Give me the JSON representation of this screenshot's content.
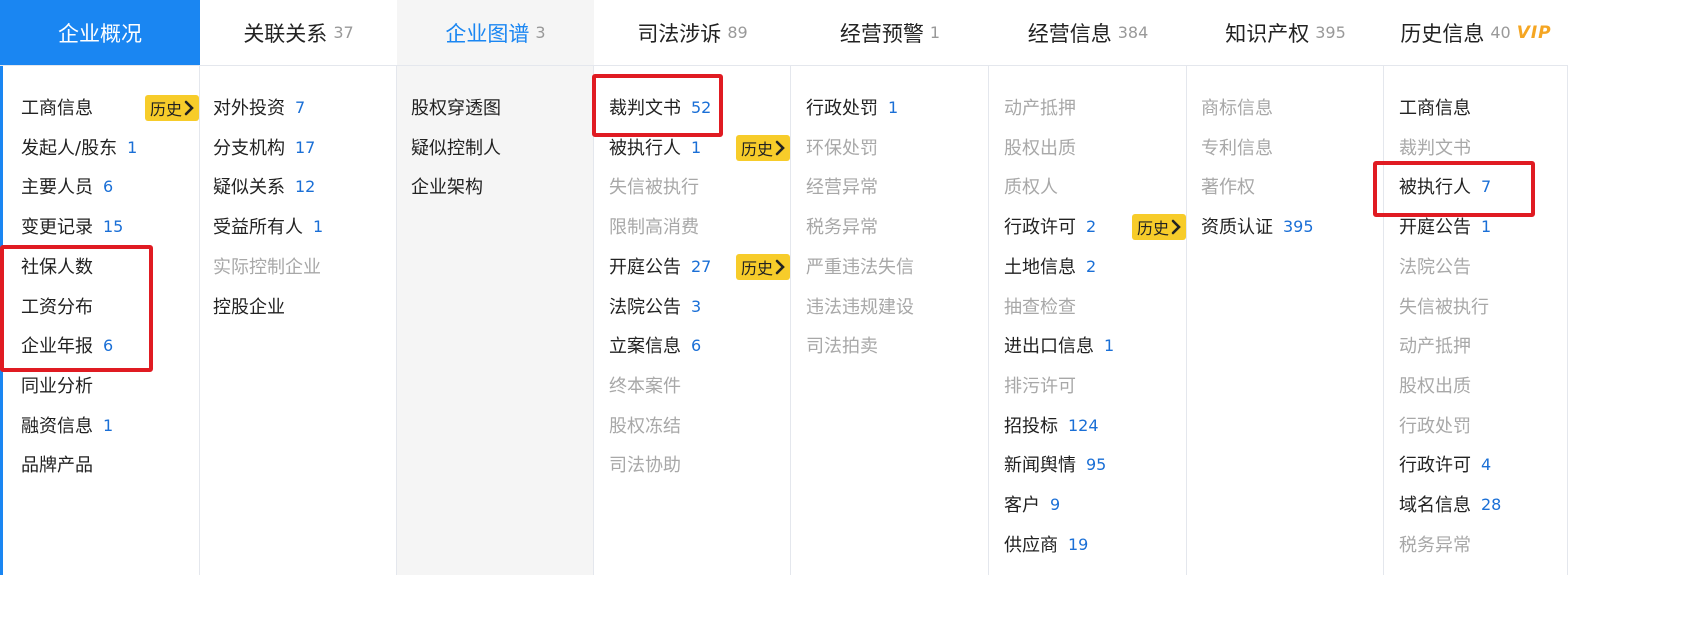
{
  "tabs": [
    {
      "label": "企业概况",
      "count": "",
      "state": "active"
    },
    {
      "label": "关联关系",
      "count": "37",
      "state": "normal"
    },
    {
      "label": "企业图谱",
      "count": "3",
      "state": "shaded"
    },
    {
      "label": "司法涉诉",
      "count": "89",
      "state": "normal"
    },
    {
      "label": "经营预警",
      "count": "1",
      "state": "normal"
    },
    {
      "label": "经营信息",
      "count": "384",
      "state": "normal"
    },
    {
      "label": "知识产权",
      "count": "395",
      "state": "normal"
    },
    {
      "label": "历史信息",
      "count": "40",
      "state": "normal",
      "badge": "VIP"
    }
  ],
  "history_label": "历史",
  "columns": [
    {
      "items": [
        {
          "label": "工商信息",
          "count": "",
          "disabled": false,
          "history": true
        },
        {
          "label": "发起人/股东",
          "count": "1",
          "disabled": false
        },
        {
          "label": "主要人员",
          "count": "6",
          "disabled": false
        },
        {
          "label": "变更记录",
          "count": "15",
          "disabled": false
        },
        {
          "label": "社保人数",
          "count": "",
          "disabled": false
        },
        {
          "label": "工资分布",
          "count": "",
          "disabled": false
        },
        {
          "label": "企业年报",
          "count": "6",
          "disabled": false
        },
        {
          "label": "同业分析",
          "count": "",
          "disabled": false
        },
        {
          "label": "融资信息",
          "count": "1",
          "disabled": false
        },
        {
          "label": "品牌产品",
          "count": "",
          "disabled": false
        }
      ]
    },
    {
      "items": [
        {
          "label": "对外投资",
          "count": "7",
          "disabled": false
        },
        {
          "label": "分支机构",
          "count": "17",
          "disabled": false
        },
        {
          "label": "疑似关系",
          "count": "12",
          "disabled": false
        },
        {
          "label": "受益所有人",
          "count": "1",
          "disabled": false
        },
        {
          "label": "实际控制企业",
          "count": "",
          "disabled": true
        },
        {
          "label": "控股企业",
          "count": "",
          "disabled": false
        }
      ]
    },
    {
      "items": [
        {
          "label": "股权穿透图",
          "count": "",
          "disabled": false
        },
        {
          "label": "疑似控制人",
          "count": "",
          "disabled": false
        },
        {
          "label": "企业架构",
          "count": "",
          "disabled": false
        }
      ]
    },
    {
      "items": [
        {
          "label": "裁判文书",
          "count": "52",
          "disabled": false
        },
        {
          "label": "被执行人",
          "count": "1",
          "disabled": false,
          "history": true
        },
        {
          "label": "失信被执行",
          "count": "",
          "disabled": true
        },
        {
          "label": "限制高消费",
          "count": "",
          "disabled": true
        },
        {
          "label": "开庭公告",
          "count": "27",
          "disabled": false,
          "history": true
        },
        {
          "label": "法院公告",
          "count": "3",
          "disabled": false
        },
        {
          "label": "立案信息",
          "count": "6",
          "disabled": false
        },
        {
          "label": "终本案件",
          "count": "",
          "disabled": true
        },
        {
          "label": "股权冻结",
          "count": "",
          "disabled": true
        },
        {
          "label": "司法协助",
          "count": "",
          "disabled": true
        }
      ]
    },
    {
      "items": [
        {
          "label": "行政处罚",
          "count": "1",
          "disabled": false
        },
        {
          "label": "环保处罚",
          "count": "",
          "disabled": true
        },
        {
          "label": "经营异常",
          "count": "",
          "disabled": true
        },
        {
          "label": "税务异常",
          "count": "",
          "disabled": true
        },
        {
          "label": "严重违法失信",
          "count": "",
          "disabled": true
        },
        {
          "label": "违法违规建设",
          "count": "",
          "disabled": true
        },
        {
          "label": "司法拍卖",
          "count": "",
          "disabled": true
        }
      ]
    },
    {
      "items": [
        {
          "label": "动产抵押",
          "count": "",
          "disabled": true
        },
        {
          "label": "股权出质",
          "count": "",
          "disabled": true
        },
        {
          "label": "质权人",
          "count": "",
          "disabled": true
        },
        {
          "label": "行政许可",
          "count": "2",
          "disabled": false,
          "history": true
        },
        {
          "label": "土地信息",
          "count": "2",
          "disabled": false
        },
        {
          "label": "抽查检查",
          "count": "",
          "disabled": true
        },
        {
          "label": "进出口信息",
          "count": "1",
          "disabled": false
        },
        {
          "label": "排污许可",
          "count": "",
          "disabled": true
        },
        {
          "label": "招投标",
          "count": "124",
          "disabled": false
        },
        {
          "label": "新闻舆情",
          "count": "95",
          "disabled": false
        },
        {
          "label": "客户",
          "count": "9",
          "disabled": false
        },
        {
          "label": "供应商",
          "count": "19",
          "disabled": false
        }
      ]
    },
    {
      "items": [
        {
          "label": "商标信息",
          "count": "",
          "disabled": true
        },
        {
          "label": "专利信息",
          "count": "",
          "disabled": true
        },
        {
          "label": "著作权",
          "count": "",
          "disabled": true
        },
        {
          "label": "资质认证",
          "count": "395",
          "disabled": false
        }
      ]
    },
    {
      "items": [
        {
          "label": "工商信息",
          "count": "",
          "disabled": false
        },
        {
          "label": "裁判文书",
          "count": "",
          "disabled": true
        },
        {
          "label": "被执行人",
          "count": "7",
          "disabled": false
        },
        {
          "label": "开庭公告",
          "count": "1",
          "disabled": false
        },
        {
          "label": "法院公告",
          "count": "",
          "disabled": true
        },
        {
          "label": "失信被执行",
          "count": "",
          "disabled": true
        },
        {
          "label": "动产抵押",
          "count": "",
          "disabled": true
        },
        {
          "label": "股权出质",
          "count": "",
          "disabled": true
        },
        {
          "label": "行政处罚",
          "count": "",
          "disabled": true
        },
        {
          "label": "行政许可",
          "count": "4",
          "disabled": false
        },
        {
          "label": "域名信息",
          "count": "28",
          "disabled": false
        },
        {
          "label": "税务异常",
          "count": "",
          "disabled": true
        }
      ]
    }
  ],
  "colors": {
    "active_tab": "#1a86f2",
    "history_badge": "#f7cc2a",
    "highlight_box": "#e01b22",
    "count_text": "#1a6fd6",
    "vip_badge": "#f5a623"
  }
}
